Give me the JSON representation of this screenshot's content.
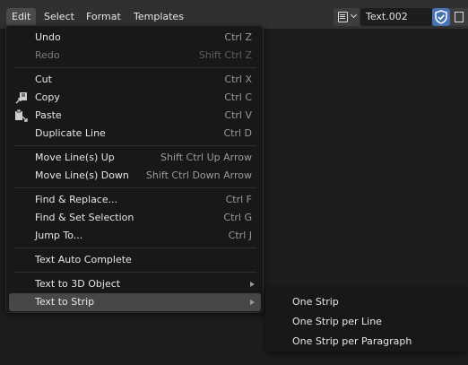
{
  "menubar": {
    "items": [
      "Edit",
      "Select",
      "Format",
      "Templates"
    ],
    "active": "Edit"
  },
  "header": {
    "text_datablock": "Text.002",
    "icons": [
      "text-view-icon",
      "chevron-down-icon",
      "fake-user-shield-icon",
      "new-text-icon"
    ]
  },
  "colors": {
    "accent": "#4772b3",
    "menu_bg": "#181818",
    "highlight": "#474747"
  },
  "edit_menu": {
    "undo": {
      "label": "Undo",
      "shortcut": "Ctrl Z"
    },
    "redo": {
      "label": "Redo",
      "shortcut": "Shift Ctrl Z"
    },
    "cut": {
      "label": "Cut",
      "shortcut": "Ctrl X"
    },
    "copy": {
      "label": "Copy",
      "shortcut": "Ctrl C"
    },
    "paste": {
      "label": "Paste",
      "shortcut": "Ctrl V"
    },
    "duplicate": {
      "label": "Duplicate Line",
      "shortcut": "Ctrl D"
    },
    "move_up": {
      "label": "Move Line(s) Up",
      "shortcut": "Shift Ctrl Up Arrow"
    },
    "move_down": {
      "label": "Move Line(s) Down",
      "shortcut": "Shift Ctrl Down Arrow"
    },
    "find_replace": {
      "label": "Find & Replace...",
      "shortcut": "Ctrl F"
    },
    "find_set": {
      "label": "Find & Set Selection",
      "shortcut": "Ctrl G"
    },
    "jump": {
      "label": "Jump To...",
      "shortcut": "Ctrl J"
    },
    "autocomplete": {
      "label": "Text Auto Complete"
    },
    "to_3d": {
      "label": "Text to 3D Object"
    },
    "to_strip": {
      "label": "Text to Strip"
    }
  },
  "strip_submenu": {
    "items": [
      "One Strip",
      "One Strip per Line",
      "One Strip per Paragraph"
    ]
  }
}
